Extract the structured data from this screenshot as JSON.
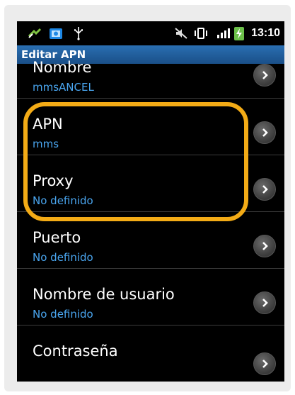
{
  "statusbar": {
    "time": "13:10",
    "icons": [
      "usb-tethering-icon",
      "store-icon",
      "usb-icon",
      "mute-icon",
      "vibrate-icon",
      "signal-icon",
      "battery-charging-icon"
    ]
  },
  "header": {
    "title": "Editar APN"
  },
  "preferences": [
    {
      "title": "Nombre",
      "summary": "mmsANCEL"
    },
    {
      "title": "APN",
      "summary": "mms"
    },
    {
      "title": "Proxy",
      "summary": "No definido"
    },
    {
      "title": "Puerto",
      "summary": "No definido"
    },
    {
      "title": "Nombre de usuario",
      "summary": "No definido"
    },
    {
      "title": "Contraseña",
      "summary": ""
    }
  ],
  "colors": {
    "title_bar": "#1f5c9c",
    "summary_text": "#4aa6f0",
    "highlight": "#f3ab16"
  }
}
